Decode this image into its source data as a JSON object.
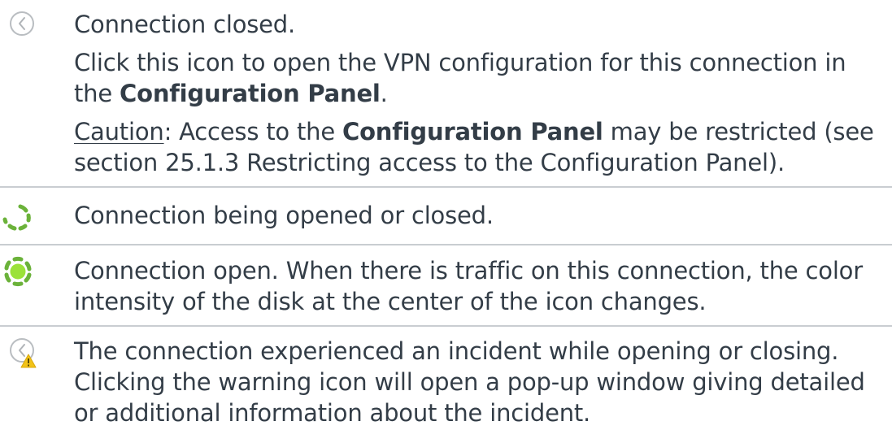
{
  "rows": [
    {
      "icon": "closed-connection-icon",
      "lines": {
        "status": "Connection closed.",
        "click_pre": "Click this icon to open the VPN configuration for this connection in the ",
        "click_bold": "Configuration Panel",
        "click_post": ".",
        "caution_label": "Caution",
        "caution_pre": ": Access to the ",
        "caution_bold": "Configuration Panel",
        "caution_post": " may be restricted (see section 25.1.3 Restricting access to the Configuration Panel)."
      }
    },
    {
      "icon": "connecting-spinner-icon",
      "text": "Connection being opened or closed."
    },
    {
      "icon": "open-connection-icon",
      "text": "Connection open. When there is traffic on this connection, the color intensity of the disk at the center of the icon changes."
    },
    {
      "icon": "warning-connection-icon",
      "text": "The connection experienced an incident while opening or closing. Clicking the warning icon will open a pop-up window giving detailed or additional information about the incident."
    }
  ],
  "colors": {
    "text": "#333d47",
    "separator": "#c9cdd1",
    "spinner_green": "#6bb23a",
    "disk_green": "#9be23a",
    "warning_yellow": "#f2c318",
    "icon_gray": "#b5b9bd"
  }
}
